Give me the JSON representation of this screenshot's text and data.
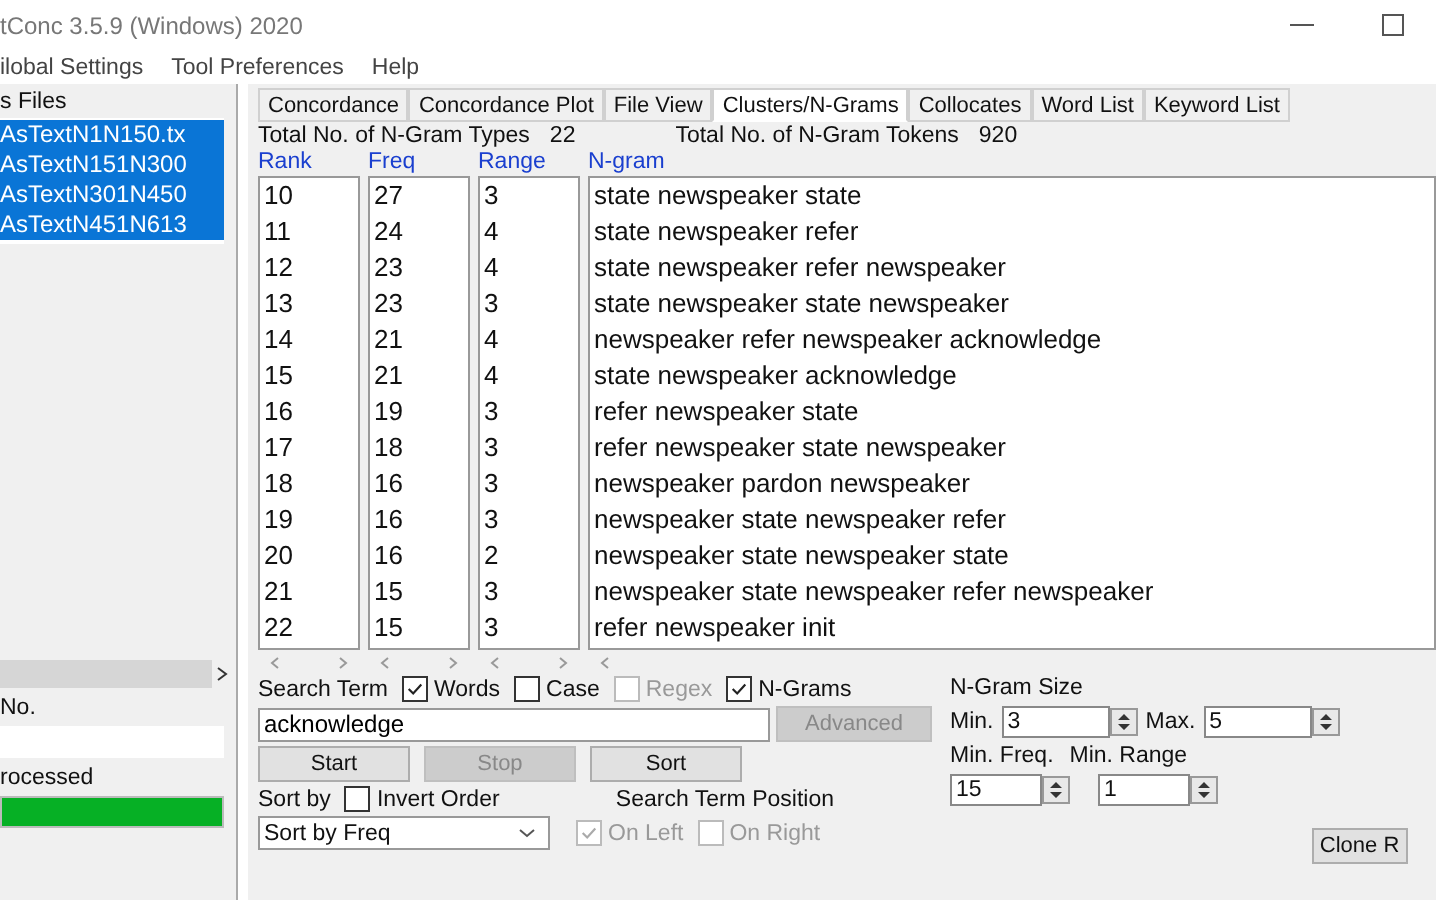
{
  "window": {
    "title": "tConc 3.5.9 (Windows) 2020"
  },
  "menu": [
    "ilobal Settings",
    "Tool Preferences",
    "Help"
  ],
  "files_panel": {
    "title": "s Files",
    "files": [
      {
        "name": "AsTextN1N150.tx",
        "selected": true
      },
      {
        "name": "AsTextN151N300",
        "selected": true
      },
      {
        "name": "AsTextN301N450",
        "selected": true
      },
      {
        "name": "AsTextN451N613",
        "selected": true
      }
    ],
    "number_label": "No.",
    "processed_label": "rocessed",
    "progress": {
      "level": 1
    }
  },
  "tabs": [
    {
      "label": "Concordance",
      "selected": false
    },
    {
      "label": "Concordance Plot",
      "selected": false
    },
    {
      "label": "File View",
      "selected": false
    },
    {
      "label": "Clusters/N-Grams",
      "selected": true
    },
    {
      "label": "Collocates",
      "selected": false
    },
    {
      "label": "Word List",
      "selected": false
    },
    {
      "label": "Keyword List",
      "selected": false
    }
  ],
  "totals": [
    {
      "label": "Total No. of N-Gram Types",
      "value": "22"
    },
    {
      "label": "Total No. of N-Gram Tokens",
      "value": "920"
    }
  ],
  "table": {
    "columns": [
      "Rank",
      "Freq",
      "Range",
      "N-gram"
    ],
    "rows": [
      [
        "10",
        "27",
        "3",
        "state newspeaker state"
      ],
      [
        "11",
        "24",
        "4",
        "state newspeaker refer"
      ],
      [
        "12",
        "23",
        "4",
        "state newspeaker refer newspeaker"
      ],
      [
        "13",
        "23",
        "3",
        "state newspeaker state newspeaker"
      ],
      [
        "14",
        "21",
        "4",
        "newspeaker refer newspeaker acknowledge"
      ],
      [
        "15",
        "21",
        "4",
        "state newspeaker acknowledge"
      ],
      [
        "16",
        "19",
        "3",
        "refer newspeaker state"
      ],
      [
        "17",
        "18",
        "3",
        "refer newspeaker state newspeaker"
      ],
      [
        "18",
        "16",
        "3",
        "newspeaker pardon newspeaker"
      ],
      [
        "19",
        "16",
        "3",
        "newspeaker state newspeaker refer"
      ],
      [
        "20",
        "16",
        "2",
        "newspeaker state newspeaker state"
      ],
      [
        "21",
        "15",
        "3",
        "newspeaker state newspeaker refer newspeaker"
      ],
      [
        "22",
        "15",
        "3",
        "refer newspeaker init"
      ]
    ]
  },
  "search": {
    "label": "Search Term",
    "options": [
      {
        "label": "Words",
        "checked": true,
        "disabled": false
      },
      {
        "label": "Case",
        "checked": false,
        "disabled": false
      },
      {
        "label": "Regex",
        "checked": false,
        "disabled": true
      },
      {
        "label": "N-Grams",
        "checked": true,
        "disabled": false
      }
    ],
    "value": "acknowledge",
    "advanced": {
      "label": "Advanced",
      "disabled": true
    }
  },
  "actions": [
    {
      "label": "Start",
      "disabled": false
    },
    {
      "label": "Stop",
      "disabled": true
    },
    {
      "label": "Sort",
      "disabled": false
    }
  ],
  "sort": {
    "label": "Sort by",
    "invert": {
      "label": "Invert Order",
      "checked": false
    },
    "value": "Sort by Freq"
  },
  "position": {
    "label": "Search Term Position",
    "options": [
      {
        "label": "On Left",
        "checked": true,
        "disabled": true
      },
      {
        "label": "On Right",
        "checked": false,
        "disabled": true
      }
    ]
  },
  "ngram_size": {
    "label": "N-Gram Size",
    "min_label": "Min.",
    "min": "3",
    "max_label": "Max.",
    "max": "5"
  },
  "limits": [
    {
      "label": "Min. Freq.",
      "value": "15"
    },
    {
      "label": "Min. Range",
      "value": "1"
    }
  ],
  "clone_button": "Clone R"
}
